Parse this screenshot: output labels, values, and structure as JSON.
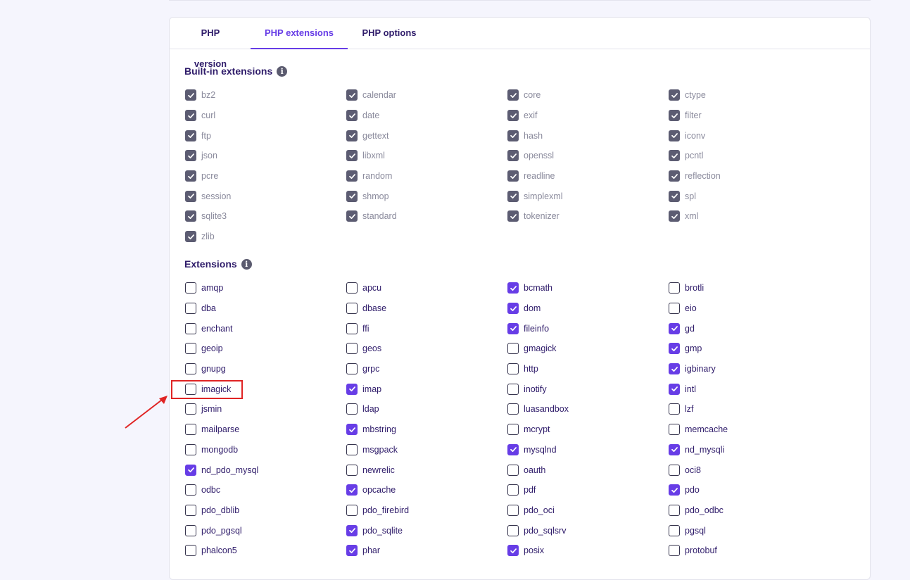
{
  "tabs": [
    {
      "label": "PHP version",
      "active": false
    },
    {
      "label": "PHP extensions",
      "active": true
    },
    {
      "label": "PHP options",
      "active": false
    }
  ],
  "builtin": {
    "title": "Built-in extensions",
    "items": [
      {
        "label": "bz2",
        "checked": true
      },
      {
        "label": "calendar",
        "checked": true
      },
      {
        "label": "core",
        "checked": true
      },
      {
        "label": "ctype",
        "checked": true
      },
      {
        "label": "curl",
        "checked": true
      },
      {
        "label": "date",
        "checked": true
      },
      {
        "label": "exif",
        "checked": true
      },
      {
        "label": "filter",
        "checked": true
      },
      {
        "label": "ftp",
        "checked": true
      },
      {
        "label": "gettext",
        "checked": true
      },
      {
        "label": "hash",
        "checked": true
      },
      {
        "label": "iconv",
        "checked": true
      },
      {
        "label": "json",
        "checked": true
      },
      {
        "label": "libxml",
        "checked": true
      },
      {
        "label": "openssl",
        "checked": true
      },
      {
        "label": "pcntl",
        "checked": true
      },
      {
        "label": "pcre",
        "checked": true
      },
      {
        "label": "random",
        "checked": true
      },
      {
        "label": "readline",
        "checked": true
      },
      {
        "label": "reflection",
        "checked": true
      },
      {
        "label": "session",
        "checked": true
      },
      {
        "label": "shmop",
        "checked": true
      },
      {
        "label": "simplexml",
        "checked": true
      },
      {
        "label": "spl",
        "checked": true
      },
      {
        "label": "sqlite3",
        "checked": true
      },
      {
        "label": "standard",
        "checked": true
      },
      {
        "label": "tokenizer",
        "checked": true
      },
      {
        "label": "xml",
        "checked": true
      },
      {
        "label": "zlib",
        "checked": true
      }
    ]
  },
  "extensions": {
    "title": "Extensions",
    "items": [
      {
        "label": "amqp",
        "checked": false
      },
      {
        "label": "apcu",
        "checked": false
      },
      {
        "label": "bcmath",
        "checked": true
      },
      {
        "label": "brotli",
        "checked": false
      },
      {
        "label": "dba",
        "checked": false
      },
      {
        "label": "dbase",
        "checked": false
      },
      {
        "label": "dom",
        "checked": true
      },
      {
        "label": "eio",
        "checked": false
      },
      {
        "label": "enchant",
        "checked": false
      },
      {
        "label": "ffi",
        "checked": false
      },
      {
        "label": "fileinfo",
        "checked": true
      },
      {
        "label": "gd",
        "checked": true
      },
      {
        "label": "geoip",
        "checked": false
      },
      {
        "label": "geos",
        "checked": false
      },
      {
        "label": "gmagick",
        "checked": false
      },
      {
        "label": "gmp",
        "checked": true
      },
      {
        "label": "gnupg",
        "checked": false
      },
      {
        "label": "grpc",
        "checked": false
      },
      {
        "label": "http",
        "checked": false
      },
      {
        "label": "igbinary",
        "checked": true
      },
      {
        "label": "imagick",
        "checked": false
      },
      {
        "label": "imap",
        "checked": true
      },
      {
        "label": "inotify",
        "checked": false
      },
      {
        "label": "intl",
        "checked": true
      },
      {
        "label": "jsmin",
        "checked": false
      },
      {
        "label": "ldap",
        "checked": false
      },
      {
        "label": "luasandbox",
        "checked": false
      },
      {
        "label": "lzf",
        "checked": false
      },
      {
        "label": "mailparse",
        "checked": false
      },
      {
        "label": "mbstring",
        "checked": true
      },
      {
        "label": "mcrypt",
        "checked": false
      },
      {
        "label": "memcache",
        "checked": false
      },
      {
        "label": "mongodb",
        "checked": false
      },
      {
        "label": "msgpack",
        "checked": false
      },
      {
        "label": "mysqlnd",
        "checked": true
      },
      {
        "label": "nd_mysqli",
        "checked": true
      },
      {
        "label": "nd_pdo_mysql",
        "checked": true
      },
      {
        "label": "newrelic",
        "checked": false
      },
      {
        "label": "oauth",
        "checked": false
      },
      {
        "label": "oci8",
        "checked": false
      },
      {
        "label": "odbc",
        "checked": false
      },
      {
        "label": "opcache",
        "checked": true
      },
      {
        "label": "pdf",
        "checked": false
      },
      {
        "label": "pdo",
        "checked": true
      },
      {
        "label": "pdo_dblib",
        "checked": false
      },
      {
        "label": "pdo_firebird",
        "checked": false
      },
      {
        "label": "pdo_oci",
        "checked": false
      },
      {
        "label": "pdo_odbc",
        "checked": false
      },
      {
        "label": "pdo_pgsql",
        "checked": false
      },
      {
        "label": "pdo_sqlite",
        "checked": true
      },
      {
        "label": "pdo_sqlsrv",
        "checked": false
      },
      {
        "label": "pgsql",
        "checked": false
      },
      {
        "label": "phalcon5",
        "checked": false
      },
      {
        "label": "phar",
        "checked": true
      },
      {
        "label": "posix",
        "checked": true
      },
      {
        "label": "protobuf",
        "checked": false
      }
    ]
  },
  "colors": {
    "accent": "#673de6",
    "disabled_check": "#5c5c72",
    "annotation": "#e02424"
  }
}
